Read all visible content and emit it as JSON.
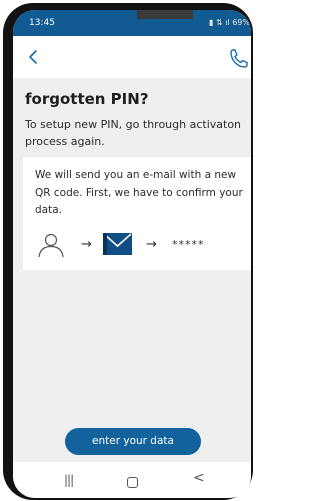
{
  "status_bar": {
    "time": "13:45",
    "battery": "69%",
    "signal": "∡ ⚡▙ ul"
  },
  "nav": {
    "back_icon": "chevron-left-icon",
    "call_icon": "phone-icon"
  },
  "page": {
    "title": "forgotten PIN?",
    "subtitle": "To setup new PIN, go through activaton process again."
  },
  "card": {
    "text": "We will send you an e-mail with a new QR code. First, we have to confirm your data.",
    "steps": [
      "user-icon",
      "arrow-right-icon",
      "mail-icon",
      "arrow-right-icon",
      "pin-mask"
    ],
    "arrow": "→",
    "pin_mask": "*****"
  },
  "cta": {
    "label": "enter your data"
  },
  "system_nav": {
    "recent": "|||",
    "back": "<"
  },
  "colors": {
    "brand": "#12629e",
    "status_bar": "#125a92",
    "background": "#efefef"
  }
}
